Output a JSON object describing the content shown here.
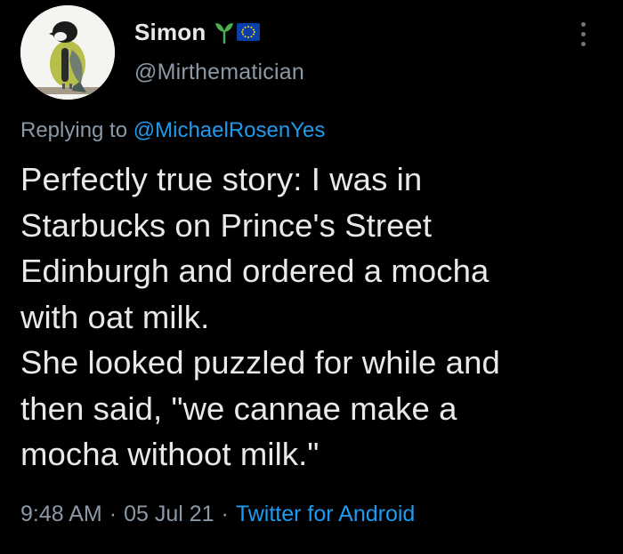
{
  "user": {
    "display_name": "Simon",
    "handle": "@Mirthematician",
    "avatar": "bird-avatar",
    "badges": [
      "sprout-icon",
      "eu-flag-icon"
    ]
  },
  "reply": {
    "prefix": "Replying to ",
    "mention": "@MichaelRosenYes"
  },
  "tweet": {
    "text": "Perfectly true story: I was in\nStarbucks on Prince's Street\nEdinburgh and ordered a mocha\nwith oat milk.\nShe looked puzzled for while and\nthen said, \"we cannae make a\nmocha withoot milk.\""
  },
  "meta": {
    "time": "9:48 AM",
    "separator": "·",
    "date": "05 Jul 21",
    "source": "Twitter for Android"
  },
  "colors": {
    "background": "#000000",
    "text": "#e7e9ea",
    "secondary": "#8b98a5",
    "link": "#1d9bf0",
    "sprout": "#4caf50",
    "eu_blue": "#0b3ea8",
    "eu_star": "#ffdd00"
  },
  "icons": {
    "more": "more-vertical-icon"
  }
}
